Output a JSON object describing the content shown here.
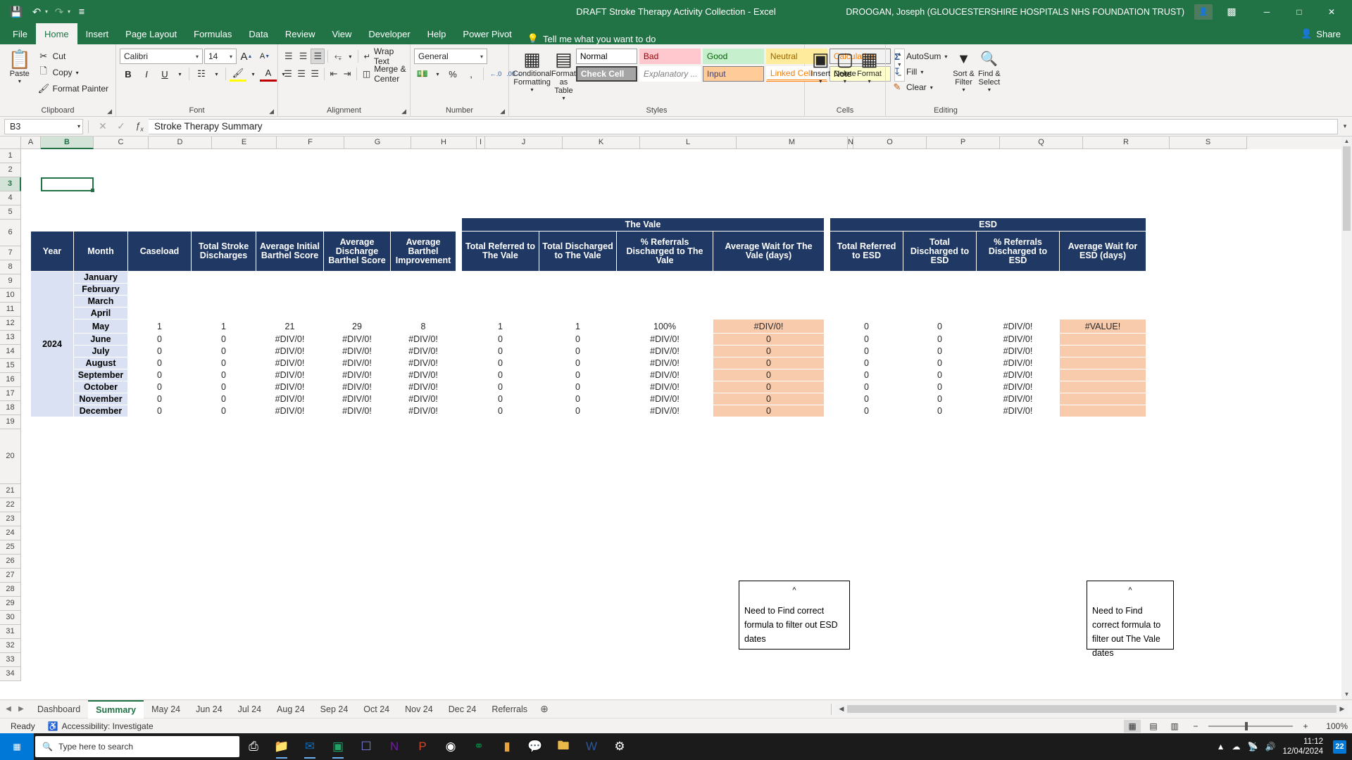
{
  "titlebar": {
    "save_icon": "save-icon",
    "undo_icon": "undo-icon",
    "redo_icon": "redo-icon",
    "customize_icon": "customize-quick-access-icon",
    "document_title": "DRAFT Stroke Therapy Activity Collection  -  Excel",
    "user_name": "DROOGAN, Joseph (GLOUCESTERSHIRE HOSPITALS NHS FOUNDATION TRUST)",
    "minimize": "─",
    "maximize": "□",
    "close": "✕"
  },
  "ribbon_tabs": [
    {
      "label": "File",
      "active": false
    },
    {
      "label": "Home",
      "active": true
    },
    {
      "label": "Insert",
      "active": false
    },
    {
      "label": "Page Layout",
      "active": false
    },
    {
      "label": "Formulas",
      "active": false
    },
    {
      "label": "Data",
      "active": false
    },
    {
      "label": "Review",
      "active": false
    },
    {
      "label": "View",
      "active": false
    },
    {
      "label": "Developer",
      "active": false
    },
    {
      "label": "Help",
      "active": false
    },
    {
      "label": "Power Pivot",
      "active": false
    }
  ],
  "tell_me": "Tell me what you want to do",
  "share": "Share",
  "ribbon": {
    "clipboard": {
      "group_label": "Clipboard",
      "paste": "Paste",
      "cut": "Cut",
      "copy": "Copy",
      "format_painter": "Format Painter"
    },
    "font": {
      "group_label": "Font",
      "font_name": "Calibri",
      "font_size": "14",
      "grow_font": "A",
      "shrink_font": "A",
      "bold": "B",
      "italic": "I",
      "underline": "U"
    },
    "alignment": {
      "group_label": "Alignment",
      "wrap_text": "Wrap Text",
      "merge_center": "Merge & Center"
    },
    "number": {
      "group_label": "Number",
      "format": "General",
      "percent": "%",
      "comma": ","
    },
    "styles": {
      "group_label": "Styles",
      "conditional_formatting": "Conditional Formatting",
      "format_as_table": "Format as Table",
      "cell_styles": [
        {
          "label": "Normal",
          "bg": "#ffffff",
          "color": "#000000",
          "border": "#b0b0b0"
        },
        {
          "label": "Bad",
          "bg": "#ffc7ce",
          "color": "#9c0006",
          "border": "#ffc7ce"
        },
        {
          "label": "Good",
          "bg": "#c6efce",
          "color": "#006100",
          "border": "#c6efce"
        },
        {
          "label": "Neutral",
          "bg": "#ffeb9c",
          "color": "#9c6500",
          "border": "#ffeb9c"
        },
        {
          "label": "Calculation",
          "bg": "#f2f2f2",
          "color": "#fa7d00",
          "border": "#7f7f7f"
        },
        {
          "label": "Check Cell",
          "bg": "#a5a5a5",
          "color": "#ffffff",
          "border": "#3f3f3f"
        },
        {
          "label": "Explanatory ...",
          "bg": "#ffffff",
          "color": "#7f7f7f",
          "border": "#ffffff"
        },
        {
          "label": "Input",
          "bg": "#ffcc99",
          "color": "#3f3f76",
          "border": "#7f7f7f"
        },
        {
          "label": "Linked Cell",
          "bg": "#ffffff",
          "color": "#fa7d00",
          "border": "#ffffff"
        },
        {
          "label": "Note",
          "bg": "#ffffcc",
          "color": "#000000",
          "border": "#b2b2b2"
        }
      ]
    },
    "cells": {
      "group_label": "Cells",
      "insert": "Insert",
      "delete": "Delete",
      "format": "Format"
    },
    "editing": {
      "group_label": "Editing",
      "autosum": "AutoSum",
      "fill": "Fill",
      "clear": "Clear",
      "sort_filter": "Sort & Filter",
      "find_select": "Find & Select"
    }
  },
  "formula_bar": {
    "name_box": "B3",
    "cancel_icon": "cancel-icon",
    "enter_icon": "confirm-icon",
    "fx_icon": "insert-function-icon",
    "value": "Stroke Therapy Summary"
  },
  "grid": {
    "columns": [
      "A",
      "B",
      "C",
      "D",
      "E",
      "F",
      "G",
      "H",
      "I",
      "J",
      "K",
      "L",
      "M",
      "N",
      "O",
      "P",
      "Q",
      "R",
      "S"
    ],
    "selected_column": "B",
    "selected_row": 3,
    "rows": [
      1,
      2,
      3,
      4,
      5,
      6,
      7,
      8,
      9,
      10,
      11,
      12,
      13,
      14,
      15,
      16,
      17,
      18,
      19,
      20,
      21,
      22,
      23,
      24,
      25,
      26,
      27,
      28,
      29,
      30,
      31,
      32,
      33,
      34
    ]
  },
  "table": {
    "group_headers": [
      {
        "label": "The Vale"
      },
      {
        "label": "ESD"
      }
    ],
    "headers": [
      "Year",
      "Month",
      "Caseload",
      "Total Stroke Discharges",
      "Average Initial Barthel Score",
      "Average Discharge Barthel Score",
      "Average Barthel Improvement",
      "Total Referred to The Vale",
      "Total Discharged to The Vale",
      "% Referrals Discharged to The Vale",
      "Average Wait for The Vale (days)",
      "Total Referred to ESD",
      "Total Discharged to ESD",
      "% Referrals Discharged to ESD",
      "Average Wait for ESD (days)"
    ],
    "year": "2024",
    "rows": [
      {
        "month": "January",
        "cells": [
          "",
          "",
          "",
          "",
          "",
          "",
          "",
          "",
          "",
          "",
          ""
        ]
      },
      {
        "month": "February",
        "cells": [
          "",
          "",
          "",
          "",
          "",
          "",
          "",
          "",
          "",
          "",
          ""
        ]
      },
      {
        "month": "March",
        "cells": [
          "",
          "",
          "",
          "",
          "",
          "",
          "",
          "",
          "",
          "",
          ""
        ]
      },
      {
        "month": "April",
        "cells": [
          "",
          "",
          "",
          "",
          "",
          "",
          "",
          "",
          "",
          "",
          ""
        ]
      },
      {
        "month": "May",
        "cells": [
          "1",
          "1",
          "21",
          "29",
          "8",
          "1",
          "1",
          "100%",
          "#DIV/0!",
          "0",
          "0",
          "#DIV/0!",
          "#VALUE!"
        ]
      },
      {
        "month": "June",
        "cells": [
          "0",
          "0",
          "#DIV/0!",
          "#DIV/0!",
          "#DIV/0!",
          "0",
          "0",
          "#DIV/0!",
          "0",
          "0",
          "0",
          "#DIV/0!",
          ""
        ]
      },
      {
        "month": "July",
        "cells": [
          "0",
          "0",
          "#DIV/0!",
          "#DIV/0!",
          "#DIV/0!",
          "0",
          "0",
          "#DIV/0!",
          "0",
          "0",
          "0",
          "#DIV/0!",
          ""
        ]
      },
      {
        "month": "August",
        "cells": [
          "0",
          "0",
          "#DIV/0!",
          "#DIV/0!",
          "#DIV/0!",
          "0",
          "0",
          "#DIV/0!",
          "0",
          "0",
          "0",
          "#DIV/0!",
          ""
        ]
      },
      {
        "month": "September",
        "cells": [
          "0",
          "0",
          "#DIV/0!",
          "#DIV/0!",
          "#DIV/0!",
          "0",
          "0",
          "#DIV/0!",
          "0",
          "0",
          "0",
          "#DIV/0!",
          ""
        ]
      },
      {
        "month": "October",
        "cells": [
          "0",
          "0",
          "#DIV/0!",
          "#DIV/0!",
          "#DIV/0!",
          "0",
          "0",
          "#DIV/0!",
          "0",
          "0",
          "0",
          "#DIV/0!",
          ""
        ]
      },
      {
        "month": "November",
        "cells": [
          "0",
          "0",
          "#DIV/0!",
          "#DIV/0!",
          "#DIV/0!",
          "0",
          "0",
          "#DIV/0!",
          "0",
          "0",
          "0",
          "#DIV/0!",
          ""
        ]
      },
      {
        "month": "December",
        "cells": [
          "0",
          "0",
          "#DIV/0!",
          "#DIV/0!",
          "#DIV/0!",
          "0",
          "0",
          "#DIV/0!",
          "0",
          "0",
          "0",
          "#DIV/0!",
          ""
        ]
      }
    ]
  },
  "comments": [
    {
      "caret": "^",
      "text": "Need to Find correct formula to filter out ESD dates"
    },
    {
      "caret": "^",
      "text": "Need to Find correct formula to filter out The Vale dates"
    }
  ],
  "sheet_tabs": [
    {
      "label": "Dashboard",
      "active": false
    },
    {
      "label": "Summary",
      "active": true
    },
    {
      "label": "May 24",
      "active": false
    },
    {
      "label": "Jun 24",
      "active": false
    },
    {
      "label": "Jul 24",
      "active": false
    },
    {
      "label": "Aug 24",
      "active": false
    },
    {
      "label": "Sep 24",
      "active": false
    },
    {
      "label": "Oct 24",
      "active": false
    },
    {
      "label": "Nov 24",
      "active": false
    },
    {
      "label": "Dec 24",
      "active": false
    },
    {
      "label": "Referrals",
      "active": false
    }
  ],
  "add_sheet": "⊕",
  "status_bar": {
    "state": "Ready",
    "accessibility": "Accessibility: Investigate",
    "zoom_level": "100%"
  },
  "taskbar": {
    "search_placeholder": "Type here to search",
    "time": "11:12",
    "date": "12/04/2024",
    "notification_count": "22"
  }
}
